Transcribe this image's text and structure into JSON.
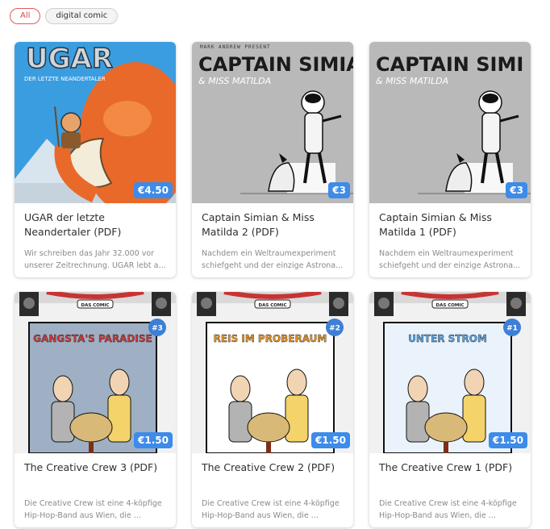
{
  "filters": [
    {
      "label": "All",
      "active": true
    },
    {
      "label": "digital comic",
      "active": false
    }
  ],
  "products": [
    {
      "title": "UGAR der letzte Neandertaler (PDF)",
      "price": "€4.50",
      "desc_lines": [
        "Wir schreiben das Jahr 32.000 vor",
        "unserer Zeitrechnung. UGAR lebt al..."
      ],
      "cover": {
        "kind": "ugar",
        "headline": "UGAR",
        "subline": "DER LETZTE NEANDERTALER",
        "bg": "#3a9de0"
      }
    },
    {
      "title": "Captain Simian & Miss Matilda 2 (PDF)",
      "price": "€3",
      "desc_lines": [
        "Nachdem ein Weltraumexperiment",
        "schiefgeht und der einzige Astrona..."
      ],
      "cover": {
        "kind": "simian",
        "headline": "CAPTAIN SIMIA",
        "subline": "& MISS MATILDA",
        "topline": "MARK ANDREW PRESENT",
        "bg": "#b9b9b9"
      }
    },
    {
      "title": "Captain Simian & Miss Matilda 1 (PDF)",
      "price": "€3",
      "desc_lines": [
        "Nachdem ein Weltraumexperiment",
        "schiefgeht und der einzige Astrona..."
      ],
      "cover": {
        "kind": "simian",
        "headline": "CAPTAIN SIMI",
        "subline": "& MISS MATILDA",
        "topline": "",
        "bg": "#b9b9b9"
      }
    },
    {
      "title": "The Creative Crew 3 (PDF)",
      "price": "€1.50",
      "desc_lines": [
        "Die Creative Crew ist eine 4-köpfige",
        "Hip-Hop-Band aus Wien, die ..."
      ],
      "cover": {
        "kind": "crew",
        "badge": "DAS COMIC",
        "issue": "#3",
        "panel_title": "GANGSTA'S PARADISE",
        "panel_bg": "#9fb0c4",
        "title_color": "#d23a3a"
      }
    },
    {
      "title": "The Creative Crew 2 (PDF)",
      "price": "€1.50",
      "desc_lines": [
        "Die Creative Crew ist eine 4-köpfige",
        "Hip-Hop-Band aus Wien, die ..."
      ],
      "cover": {
        "kind": "crew",
        "badge": "DAS COMIC",
        "issue": "#2",
        "panel_title": "REIS IM PROBERAUM",
        "panel_bg": "#ffffff",
        "title_color": "#e8962a"
      }
    },
    {
      "title": "The Creative Crew 1 (PDF)",
      "price": "€1.50",
      "desc_lines": [
        "Die Creative Crew ist eine 4-köpfige",
        "Hip-Hop-Band aus Wien, die ..."
      ],
      "cover": {
        "kind": "crew",
        "badge": "DAS COMIC",
        "issue": "#1",
        "panel_title": "UNTER STROM",
        "panel_bg": "#eaf3fb",
        "title_color": "#5aa7e8"
      }
    }
  ],
  "colors": {
    "accent": "#3d8bea",
    "active_filter": "#e25b5b"
  }
}
